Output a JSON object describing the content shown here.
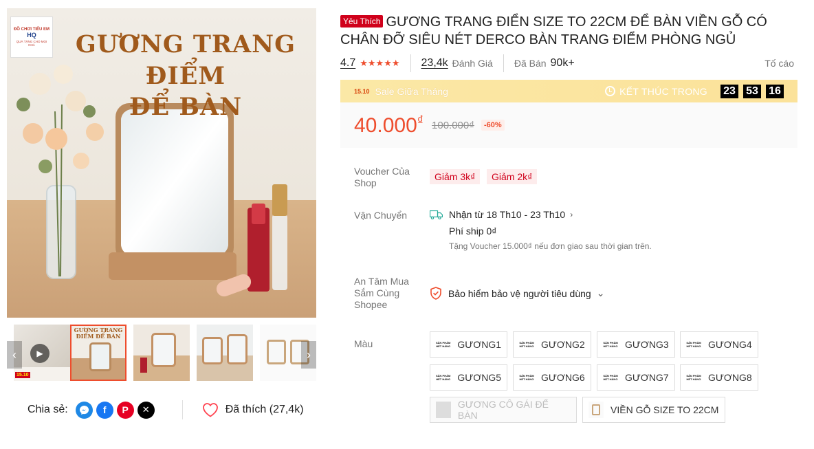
{
  "gallery": {
    "logo_line1": "ĐỒ CHƠI TIỂU EM",
    "logo_line2": "HQ",
    "logo_line3": "QUÀ TẶNG CHO MỌI NHÀ",
    "headline_line1": "GƯƠNG TRANG ĐIỂM",
    "headline_line2": "ĐỂ BÀN",
    "thumb_badge": "15.10",
    "thumb2_text": "GƯƠNG TRANG ĐIỂM ĐỂ BÀN"
  },
  "share": {
    "label": "Chia sẻ:",
    "icons": [
      "messenger-icon",
      "facebook-icon",
      "pinterest-icon",
      "x-icon"
    ]
  },
  "like": {
    "label": "Đã thích (27,4k)"
  },
  "product": {
    "badge": "Yêu Thích",
    "title": "GƯƠNG TRANG ĐIỂN SIZE TO 22CM ĐỂ BÀN VIỀN GỖ CÓ CHÂN ĐỠ SIÊU NÉT DERCO BÀN TRANG ĐIỂM PHÒNG NGỦ",
    "rating": "4.7",
    "rating_stars": "★★★★★",
    "reviews_count": "23,4k",
    "reviews_label": "Đánh Giá",
    "sold_label": "Đã Bán",
    "sold_count": "90k+",
    "report_label": "Tố cáo"
  },
  "flash_sale": {
    "logo": "15.10",
    "name": "Sale Giữa Tháng",
    "ends_label": "KẾT THÚC TRONG",
    "hours": "23",
    "minutes": "53",
    "seconds": "16"
  },
  "price": {
    "current": "40.000",
    "currency": "₫",
    "original": "100.000₫",
    "discount": "-60%"
  },
  "voucher": {
    "label": "Voucher Của Shop",
    "items": [
      "Giảm 3k₫",
      "Giảm 2k₫"
    ]
  },
  "shipping": {
    "label": "Vận Chuyển",
    "delivery": "Nhận từ 18 Th10 - 23 Th10",
    "fee": "Phí ship 0₫",
    "note": "Tặng Voucher 15.000₫ nếu đơn giao sau thời gian trên."
  },
  "insurance": {
    "label": "An Tâm Mua Sắm Cùng Shopee",
    "text": "Bảo hiểm bảo vệ người tiêu dùng"
  },
  "variants": {
    "label": "Màu",
    "thumb_text": "SẢN PHẨM HẾT HÀNG",
    "options": [
      "GƯƠNG1",
      "GƯƠNG2",
      "GƯƠNG3",
      "GƯƠNG4",
      "GƯƠNG5",
      "GƯƠNG6",
      "GƯƠNG7",
      "GƯƠNG8",
      "GƯƠNG CÔ GÁI ĐỂ BÀN",
      "VIỀN GỖ SIZE TO 22CM"
    ]
  },
  "colors": {
    "accent": "#ee4d2d",
    "flash_bg": "#fbe8a6",
    "badge_red": "#d0011b"
  }
}
